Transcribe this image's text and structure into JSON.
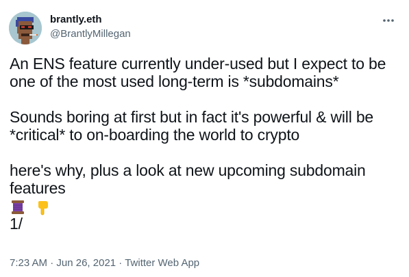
{
  "author": {
    "display_name": "brantly.eth",
    "handle": "@BrantlyMillegan"
  },
  "tweet": {
    "paragraph_1": "An ENS feature currently under-used but I expect to be one of the most used long-term is *subdomains*",
    "paragraph_2": "Sounds boring at first but in fact it's powerful & will be *critical* to on-boarding the world to crypto",
    "paragraph_3": "here's why, plus a look at new upcoming subdomain features",
    "emojis": [
      "thread-spool-emoji",
      "pointing-down-emoji"
    ],
    "thread_marker": "1/"
  },
  "meta": {
    "time": "7:23 AM",
    "separator_1": " · ",
    "date": "Jun 26, 2021",
    "separator_2": " · ",
    "source": "Twitter Web App"
  },
  "colors": {
    "text_primary": "#0f1419",
    "text_secondary": "#536471"
  }
}
